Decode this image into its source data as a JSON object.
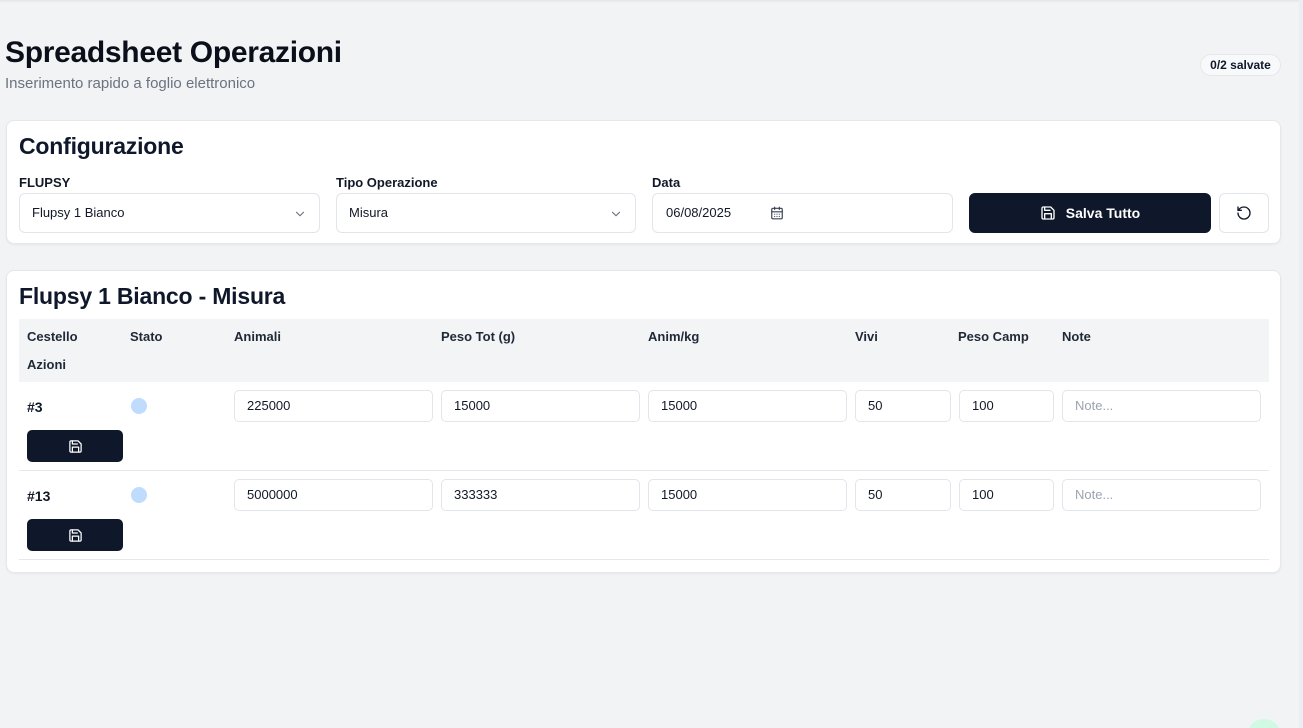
{
  "header": {
    "title": "Spreadsheet Operazioni",
    "subtitle": "Inserimento rapido a foglio elettronico",
    "saved_badge": "0/2 salvate"
  },
  "config": {
    "title": "Configurazione",
    "flupsy_label": "FLUPSY",
    "flupsy_value": "Flupsy 1 Bianco",
    "operation_label": "Tipo Operazione",
    "operation_value": "Misura",
    "date_label": "Data",
    "date_value": "06/08/2025",
    "save_all_label": "Salva Tutto"
  },
  "table": {
    "title": "Flupsy 1 Bianco - Misura",
    "columns": {
      "basket": "Cestello",
      "status": "Stato",
      "animals": "Animali",
      "total_weight": "Peso Tot (g)",
      "animals_per_kg": "Anim/kg",
      "alive": "Vivi",
      "sample_weight": "Peso Camp",
      "notes": "Note",
      "actions": "Azioni"
    },
    "notes_placeholder": "Note...",
    "rows": [
      {
        "basket": "#3",
        "animals": "225000",
        "total_weight": "15000",
        "animals_per_kg": "15000",
        "alive": "50",
        "sample_weight": "100",
        "notes": ""
      },
      {
        "basket": "#13",
        "animals": "5000000",
        "total_weight": "333333",
        "animals_per_kg": "15000",
        "alive": "50",
        "sample_weight": "100",
        "notes": ""
      }
    ]
  },
  "icons": {
    "select_chevron": "chevron-down-icon",
    "date": "calendar-icon",
    "save": "floppy-disk-icon",
    "reset": "rotate-ccw-icon"
  },
  "colors": {
    "primary": "#0f172a",
    "status_pending": "#bfdbfe",
    "background": "#f2f3f5"
  }
}
